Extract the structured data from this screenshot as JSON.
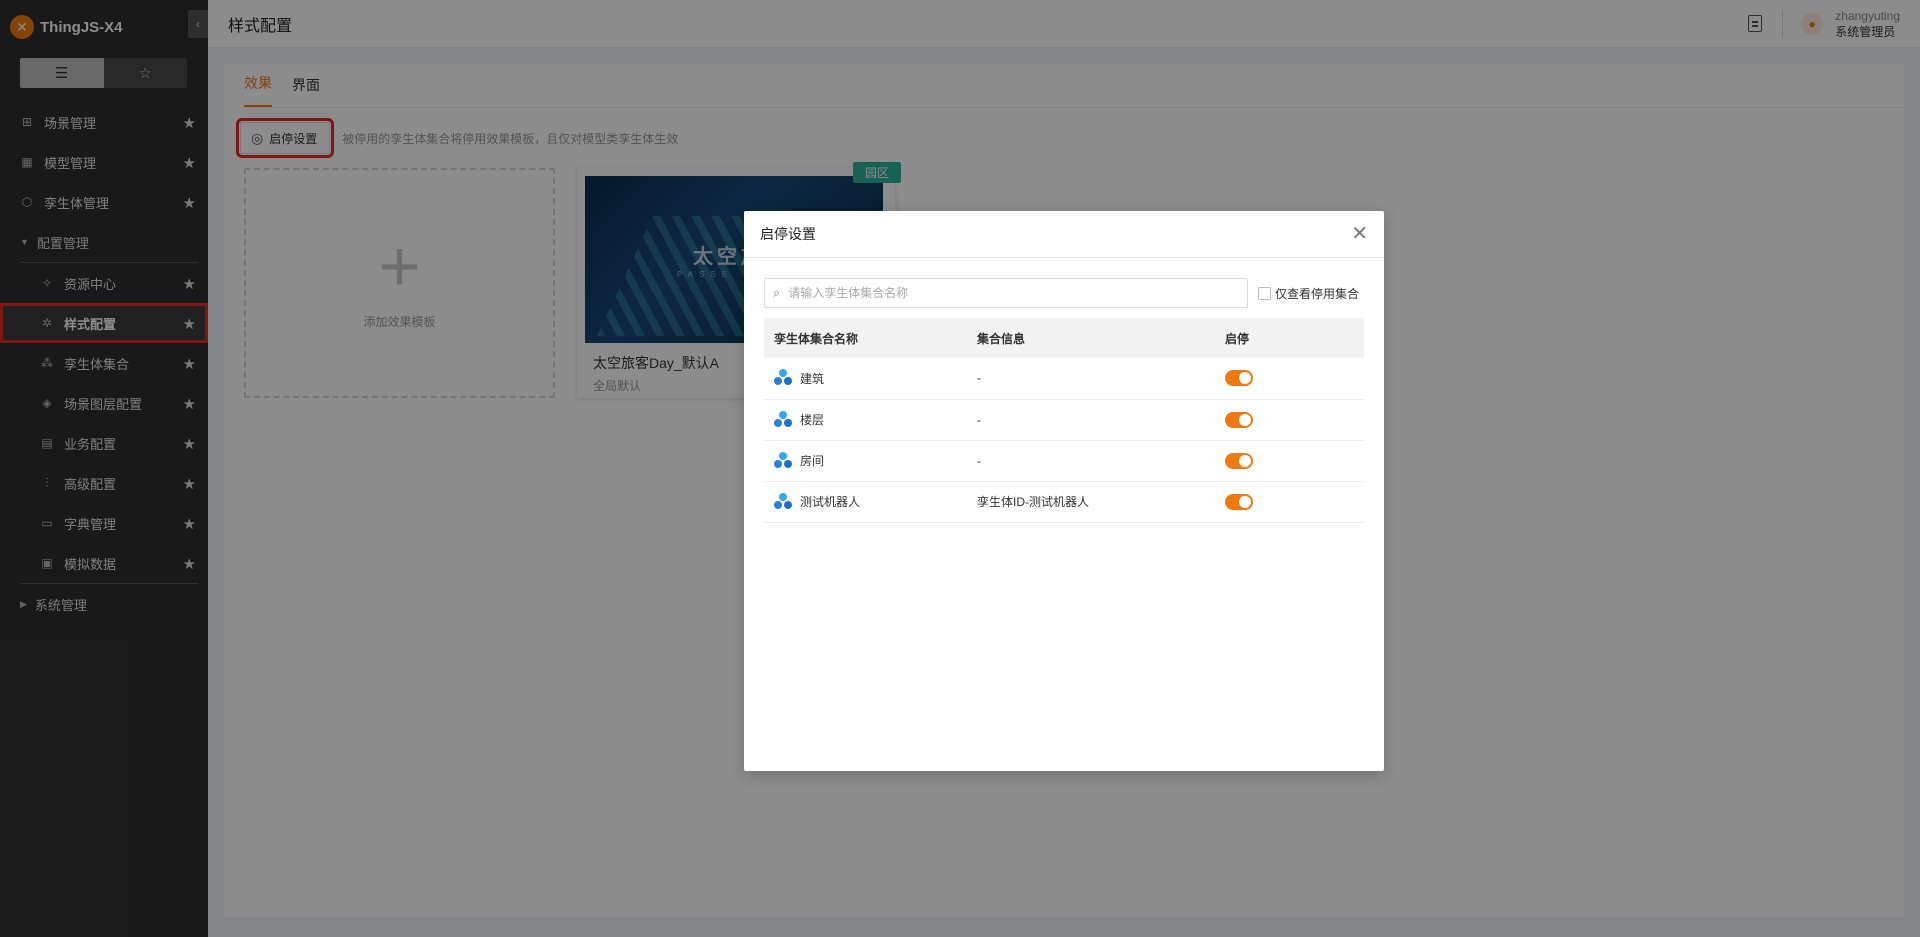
{
  "app": {
    "brand": "ThingJS-X4",
    "logo_glyph": "✕",
    "accent_color": "#f07a12",
    "collapse_glyph": "‹"
  },
  "sidebar": {
    "view_toggle": [
      {
        "name": "list-view",
        "icon": "list-icon",
        "glyph": "☰"
      },
      {
        "name": "favorites-view",
        "icon": "star-outline-icon",
        "glyph": "☆"
      }
    ],
    "items": [
      {
        "label": "场景管理",
        "icon": "grid-icon",
        "glyph": "⊞",
        "star": "★"
      },
      {
        "label": "模型管理",
        "icon": "table-icon",
        "glyph": "▦",
        "star": "★"
      },
      {
        "label": "孪生体管理",
        "icon": "cube-icon",
        "glyph": "⬡",
        "star": "★"
      },
      {
        "label": "配置管理",
        "caret": "▼"
      },
      {
        "label": "资源中心",
        "icon": "puzzle-icon",
        "glyph": "✧",
        "star": "★"
      },
      {
        "label": "样式配置",
        "icon": "style-icon",
        "glyph": "✲",
        "star": "★"
      },
      {
        "label": "孪生体集合",
        "icon": "cluster-icon",
        "glyph": "⁂",
        "star": "★"
      },
      {
        "label": "场景图层配置",
        "icon": "layers-icon",
        "glyph": "◈",
        "star": "★"
      },
      {
        "label": "业务配置",
        "icon": "business-icon",
        "glyph": "▤",
        "star": "★"
      },
      {
        "label": "高级配置",
        "icon": "sliders-icon",
        "glyph": "⫶",
        "star": "★"
      },
      {
        "label": "字典管理",
        "icon": "dictionary-icon",
        "glyph": "▭",
        "star": "★"
      },
      {
        "label": "模拟数据",
        "icon": "mock-data-icon",
        "glyph": "▣",
        "star": "★"
      },
      {
        "label": "系统管理",
        "caret": "▶"
      }
    ]
  },
  "header": {
    "title": "样式配置",
    "doc_icon": "document-icon",
    "avatar_glyph": "●",
    "user_name": "zhangyuting",
    "user_role": "系统管理员"
  },
  "main": {
    "tabs": [
      "效果",
      "界面"
    ],
    "toggle_button_label": "启停设置",
    "toggle_button_glyph": "◎",
    "hint": "被停用的孪生体集合将停用效果模板，且仅对模型类孪生体生效",
    "add_card": {
      "plus": "+",
      "label": "添加效果模板"
    },
    "template_card": {
      "tag": "园区",
      "thumb_title": "太空旅",
      "thumb_sub": "PASSE",
      "name": "太空旅客Day_默认A",
      "sub": "全局默认"
    }
  },
  "modal": {
    "title": "启停设置",
    "close_glyph": "✕",
    "search_glyph": "⌕",
    "search_placeholder": "请输入孪生体集合名称",
    "checkbox_label": "仅查看停用集合",
    "columns": [
      "孪生体集合名称",
      "集合信息",
      "启停"
    ],
    "rows": [
      {
        "name": "建筑",
        "info": "-",
        "enabled": true
      },
      {
        "name": "楼层",
        "info": "-",
        "enabled": true
      },
      {
        "name": "房间",
        "info": "-",
        "enabled": true
      },
      {
        "name": "测试机器人",
        "info": "孪生体ID-测试机器人",
        "enabled": true
      }
    ]
  }
}
